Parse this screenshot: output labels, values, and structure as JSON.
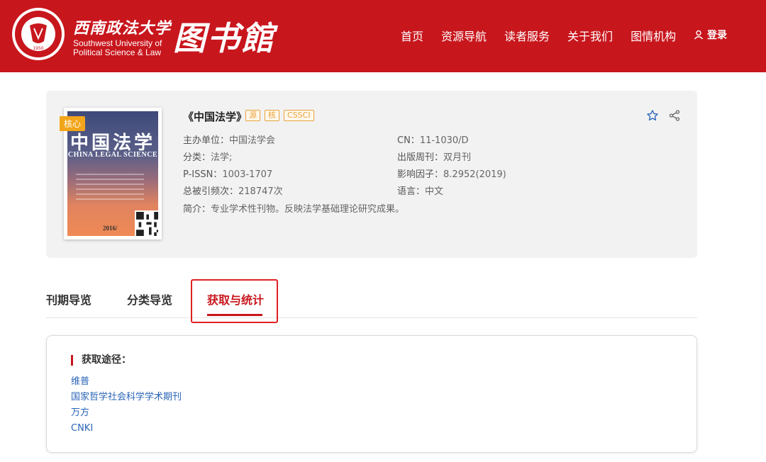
{
  "header": {
    "university_cn": "西南政法大学",
    "university_en_line1": "Southwest University of",
    "university_en_line2": "Political Science & Law",
    "library_title": "图书館",
    "emblem_year": "1950",
    "nav": [
      "首页",
      "资源导航",
      "读者服务",
      "关于我们",
      "图情机构"
    ],
    "login_label": "登录"
  },
  "journal": {
    "title": "《中国法学》",
    "badge": "核心",
    "tags": [
      "源",
      "核",
      "CSSCI"
    ],
    "cover_title_cn": "中国法学",
    "cover_title_en": "CHINA LEGAL SCIENCE",
    "cover_year": "2016/",
    "fields_left": [
      {
        "key": "主办单位：",
        "value": "中国法学会"
      },
      {
        "key": "分类：",
        "value": "法学;"
      },
      {
        "key": "P-ISSN：",
        "value": "1003-1707"
      },
      {
        "key": "总被引频次：",
        "value": "218747次"
      },
      {
        "key": "简介：",
        "value": "专业学术性刊物。反映法学基础理论研究成果。"
      }
    ],
    "fields_right": [
      {
        "key": "CN：",
        "value": "11-1030/D"
      },
      {
        "key": "出版周刊：",
        "value": "双月刊"
      },
      {
        "key": "影响因子：",
        "value": "8.2952(2019)"
      },
      {
        "key": "语言：",
        "value": "中文"
      }
    ]
  },
  "tabs": [
    {
      "label": "刊期导览",
      "active": false
    },
    {
      "label": "分类导览",
      "active": false
    },
    {
      "label": "获取与统计",
      "active": true
    }
  ],
  "access": {
    "title": "获取途径：",
    "items": [
      "维普",
      "国家哲学社会科学学术期刊",
      "万方",
      "CNKI"
    ]
  },
  "colors": {
    "brand_red": "#c8161d",
    "tag_orange": "#e8a23a",
    "link_blue": "#2a64b8"
  }
}
